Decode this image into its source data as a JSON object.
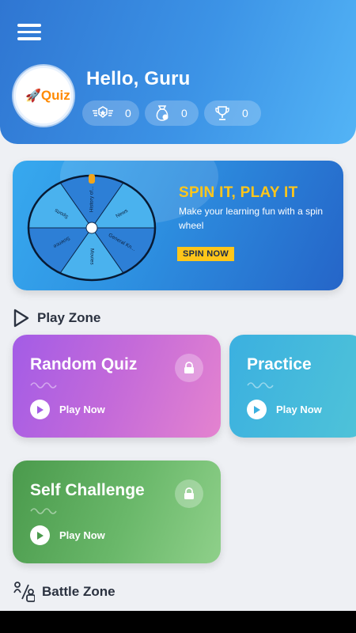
{
  "header": {
    "greeting": "Hello, Guru",
    "logo_text": "Quiz",
    "stats": [
      {
        "icon": "badge-icon",
        "value": "0"
      },
      {
        "icon": "coin-bag-icon",
        "value": "0"
      },
      {
        "icon": "trophy-icon",
        "value": "0"
      }
    ]
  },
  "banner": {
    "title": "SPIN IT, PLAY IT",
    "subtitle": "Make your learning fun with a spin wheel",
    "button": "SPIN NOW",
    "wheel_segments": [
      "History of...",
      "News",
      "General Kn...",
      "Movies",
      "Science",
      "Sports"
    ]
  },
  "play_zone": {
    "title": "Play Zone",
    "cards": [
      {
        "title": "Random Quiz",
        "action": "Play Now",
        "locked": true
      },
      {
        "title": "Practice",
        "action": "Play Now",
        "locked": false
      },
      {
        "title": "Self Challenge",
        "action": "Play Now",
        "locked": true
      }
    ]
  },
  "battle_zone": {
    "title": "Battle Zone"
  },
  "colors": {
    "accent": "#ffc61a",
    "header_blue": "#2f76d2",
    "random": "#c46ad9",
    "practice": "#4fc3d8",
    "self": "#6ab86a"
  }
}
